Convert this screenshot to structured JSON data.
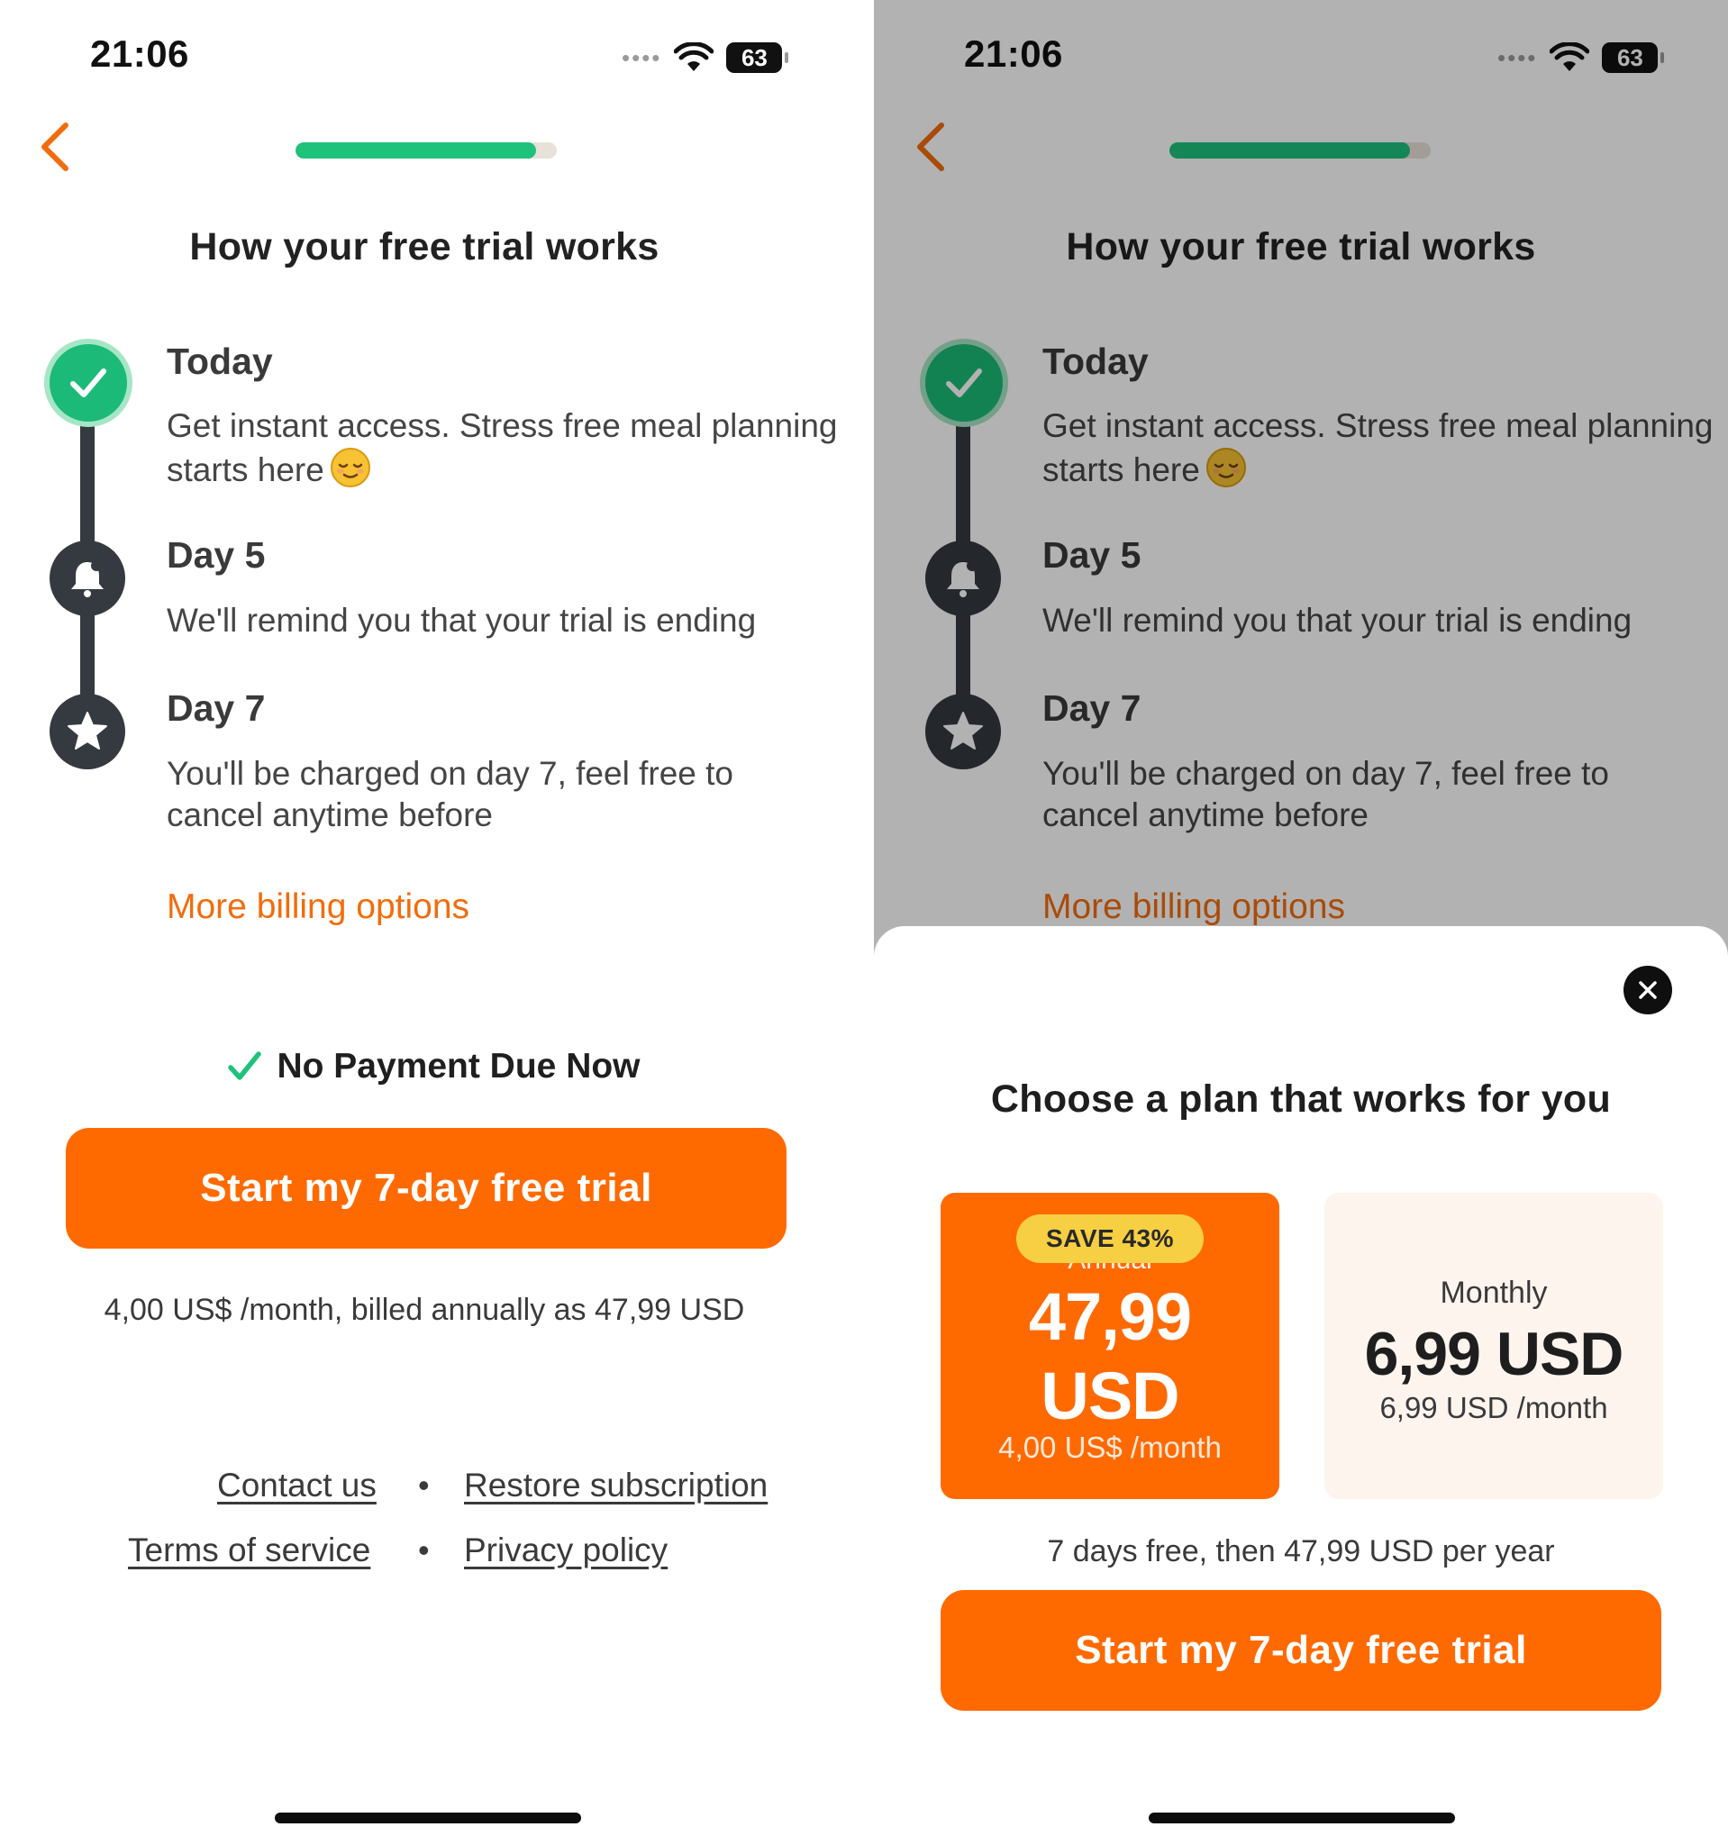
{
  "colors": {
    "accent_orange": "#ff6a00",
    "link_orange": "#f26c0d",
    "success_green": "#1fc27b",
    "timeline_dark": "#343a40",
    "badge_yellow": "#f7cf43"
  },
  "status_bar": {
    "time": "21:06",
    "battery": "63"
  },
  "onboarding": {
    "progress": 0.92,
    "title": "How your free trial works",
    "steps": [
      {
        "title": "Today",
        "description": "Get instant access. Stress free meal planning starts here",
        "icon": "check-icon"
      },
      {
        "title": "Day 5",
        "description": "We'll remind you that your trial is ending",
        "icon": "bell-icon"
      },
      {
        "title": "Day 7",
        "description": "You'll be charged on day 7, feel free to cancel anytime before",
        "icon": "star-icon"
      }
    ],
    "more_billing_link": "More billing options",
    "no_payment_text": "No Payment Due Now",
    "cta_label": "Start my 7-day free trial",
    "billing_note": "4,00 US$ /month, billed annually as 47,99 USD",
    "footer": {
      "contact": "Contact us",
      "restore": "Restore subscription",
      "terms": "Terms of service",
      "privacy": "Privacy policy",
      "separator": "•"
    }
  },
  "plan_sheet": {
    "title": "Choose a plan that works for you",
    "annual": {
      "badge": "SAVE 43%",
      "label": "Annual",
      "price_amount": "47,99",
      "price_currency": "USD",
      "per_month": "4,00 US$ /month",
      "selected": true
    },
    "monthly": {
      "label": "Monthly",
      "price": "6,99 USD",
      "per_month": "6,99 USD /month",
      "selected": false
    },
    "trial_info": "7 days free, then 47,99 USD per year",
    "cta_label": "Start my 7-day free trial"
  }
}
